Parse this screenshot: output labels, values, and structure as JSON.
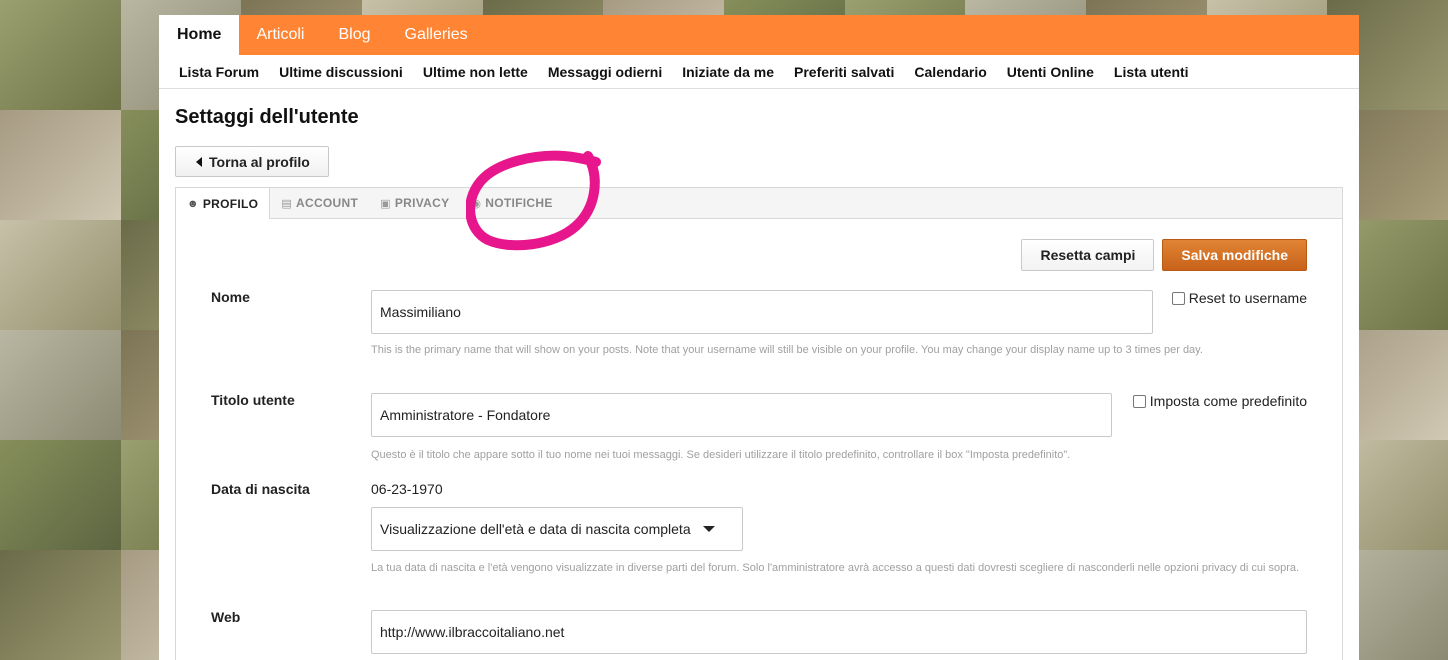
{
  "topnav": {
    "tabs": [
      {
        "label": "Home"
      },
      {
        "label": "Articoli"
      },
      {
        "label": "Blog"
      },
      {
        "label": "Galleries"
      }
    ]
  },
  "subnav": {
    "links": [
      {
        "label": "Lista Forum"
      },
      {
        "label": "Ultime discussioni"
      },
      {
        "label": "Ultime non lette"
      },
      {
        "label": "Messaggi odierni"
      },
      {
        "label": "Iniziate da me"
      },
      {
        "label": "Preferiti salvati"
      },
      {
        "label": "Calendario"
      },
      {
        "label": "Utenti Online"
      },
      {
        "label": "Lista utenti"
      }
    ]
  },
  "page": {
    "title": "Settaggi dell'utente",
    "back_label": "Torna al profilo"
  },
  "tabs": [
    {
      "label": "PROFILO",
      "icon": "user-icon"
    },
    {
      "label": "ACCOUNT",
      "icon": "id-card-icon"
    },
    {
      "label": "PRIVACY",
      "icon": "lock-icon"
    },
    {
      "label": "NOTIFICHE",
      "icon": "bell-icon"
    }
  ],
  "actions": {
    "reset_label": "Resetta campi",
    "save_label": "Salva modifiche"
  },
  "form": {
    "nome": {
      "label": "Nome",
      "value": "Massimiliano",
      "checkbox": "Reset to username",
      "help": "This is the primary name that will show on your posts. Note that your username will still be visible on your profile. You may change your display name up to 3 times per day."
    },
    "titolo": {
      "label": "Titolo utente",
      "value": "Amministratore - Fondatore",
      "checkbox": "Imposta come predefinito",
      "help": "Questo è il titolo che appare sotto il tuo nome nei tuoi messaggi. Se desideri utilizzare il titolo predefinito, controllare il box \"Imposta predefinito\"."
    },
    "nascita": {
      "label": "Data di nascita",
      "value": "06-23-1970",
      "select": "Visualizzazione dell'età  e data di nascita completa",
      "help": "La tua data di nascita e l'età  vengono visualizzate in diverse parti del forum. Solo l'amministratore avrà accesso a questi dati dovresti scegliere di nasconderli nelle opzioni privacy di cui sopra."
    },
    "web": {
      "label": "Web",
      "value": "http://www.ilbraccoitaliano.net"
    }
  },
  "colors": {
    "accent": "#ff8534",
    "save": "#c8621a",
    "annotation": "#e8168c"
  }
}
